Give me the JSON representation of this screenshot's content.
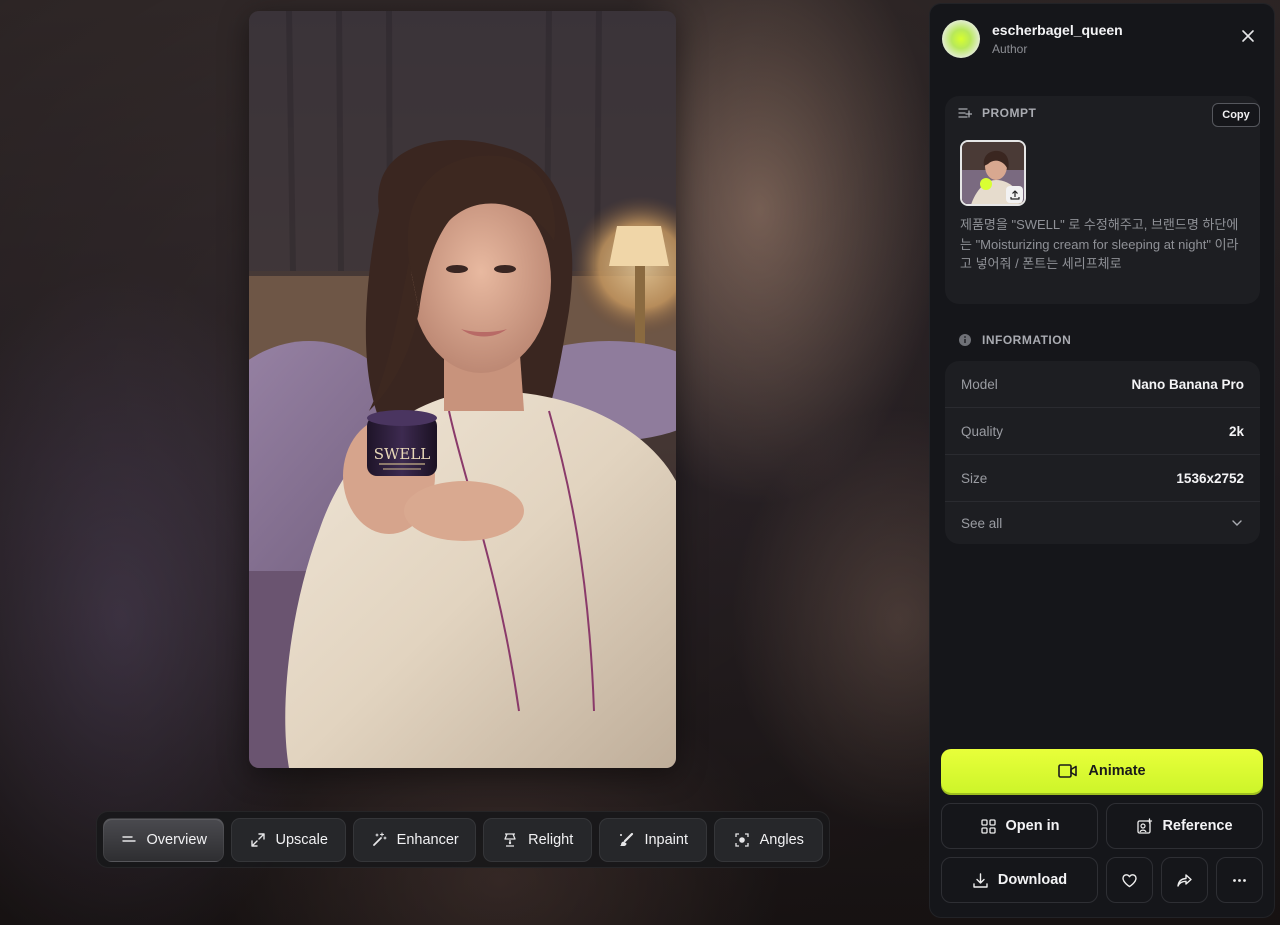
{
  "author": {
    "name": "escherbagel_queen",
    "role": "Author"
  },
  "prompt": {
    "heading": "PROMPT",
    "copy_label": "Copy",
    "text": "제품명을 \"SWELL\" 로 수정해주고, 브랜드명 하단에는 \"Moisturizing cream for sleeping at night\" 이라고 넣어줘 / 폰트는 세리프체로"
  },
  "product_label": "SWELL",
  "information": {
    "heading": "INFORMATION",
    "rows": [
      {
        "key": "Model",
        "value": "Nano Banana Pro"
      },
      {
        "key": "Quality",
        "value": "2k"
      },
      {
        "key": "Size",
        "value": "1536x2752"
      }
    ],
    "see_all": "See all"
  },
  "actions": {
    "animate": "Animate",
    "open_in": "Open in",
    "reference": "Reference",
    "download": "Download"
  },
  "toolbar": {
    "items": [
      {
        "label": "Overview",
        "icon": "overview-icon"
      },
      {
        "label": "Upscale",
        "icon": "expand-icon"
      },
      {
        "label": "Enhancer",
        "icon": "magic-wand-icon"
      },
      {
        "label": "Relight",
        "icon": "relight-icon"
      },
      {
        "label": "Inpaint",
        "icon": "brush-icon"
      },
      {
        "label": "Angles",
        "icon": "angles-icon"
      }
    ]
  },
  "colors": {
    "accent": "#d9ff33",
    "panel_bg": "#15161a",
    "card_bg": "#1d1e22"
  }
}
